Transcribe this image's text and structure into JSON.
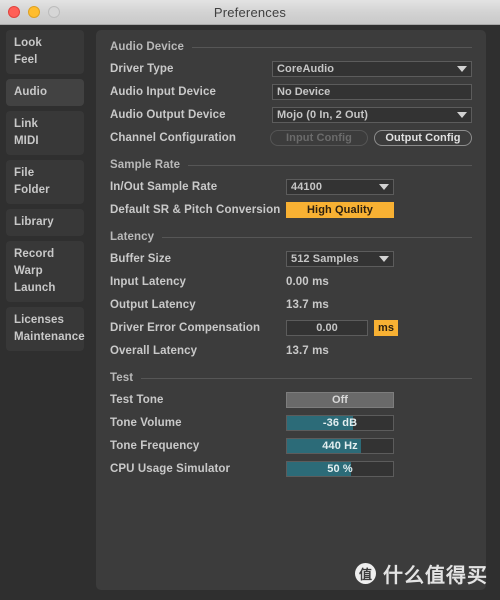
{
  "window": {
    "title": "Preferences",
    "traffic_lights": [
      "close",
      "minimize",
      "zoom"
    ]
  },
  "sidebar": {
    "groups": [
      {
        "selected": false,
        "items": [
          "Look",
          "Feel"
        ]
      },
      {
        "selected": true,
        "items": [
          "Audio"
        ]
      },
      {
        "selected": false,
        "items": [
          "Link",
          "MIDI"
        ]
      },
      {
        "selected": false,
        "items": [
          "File",
          "Folder"
        ]
      },
      {
        "selected": false,
        "items": [
          "Library"
        ]
      },
      {
        "selected": false,
        "items": [
          "Record",
          "Warp",
          "Launch"
        ]
      },
      {
        "selected": false,
        "items": [
          "Licenses",
          "Maintenance"
        ]
      }
    ]
  },
  "sections": {
    "audio_device": {
      "title": "Audio Device",
      "driver_type": {
        "label": "Driver Type",
        "value": "CoreAudio"
      },
      "audio_input_device": {
        "label": "Audio Input Device",
        "value": "No Device"
      },
      "audio_output_device": {
        "label": "Audio Output Device",
        "value": "Mojo (0 In, 2 Out)"
      },
      "channel_configuration": {
        "label": "Channel Configuration",
        "input_config": "Input Config",
        "output_config": "Output Config"
      }
    },
    "sample_rate": {
      "title": "Sample Rate",
      "in_out_sample_rate": {
        "label": "In/Out Sample Rate",
        "value": "44100"
      },
      "default_sr_pitch": {
        "label": "Default SR & Pitch Conversion",
        "value": "High Quality"
      }
    },
    "latency": {
      "title": "Latency",
      "buffer_size": {
        "label": "Buffer Size",
        "value": "512 Samples"
      },
      "input_latency": {
        "label": "Input Latency",
        "value": "0.00 ms"
      },
      "output_latency": {
        "label": "Output Latency",
        "value": "13.7 ms"
      },
      "driver_error_compensation": {
        "label": "Driver Error Compensation",
        "value": "0.00",
        "unit": "ms"
      },
      "overall_latency": {
        "label": "Overall Latency",
        "value": "13.7 ms"
      }
    },
    "test": {
      "title": "Test",
      "test_tone": {
        "label": "Test Tone",
        "value": "Off"
      },
      "tone_volume": {
        "label": "Tone Volume",
        "value": "-36 dB",
        "fill_percent": 62
      },
      "tone_frequency": {
        "label": "Tone Frequency",
        "value": "440 Hz",
        "fill_percent": 70
      },
      "cpu_usage_simulator": {
        "label": "CPU Usage Simulator",
        "value": "50 %",
        "fill_percent": 60
      }
    }
  },
  "watermark": {
    "badge": "值",
    "text": "什么值得买"
  },
  "colors": {
    "accent_amber": "#f8b133",
    "slider_fill": "#2c6b78",
    "panel_bg": "#3c3c3c",
    "window_bg": "#2f2f2f"
  }
}
